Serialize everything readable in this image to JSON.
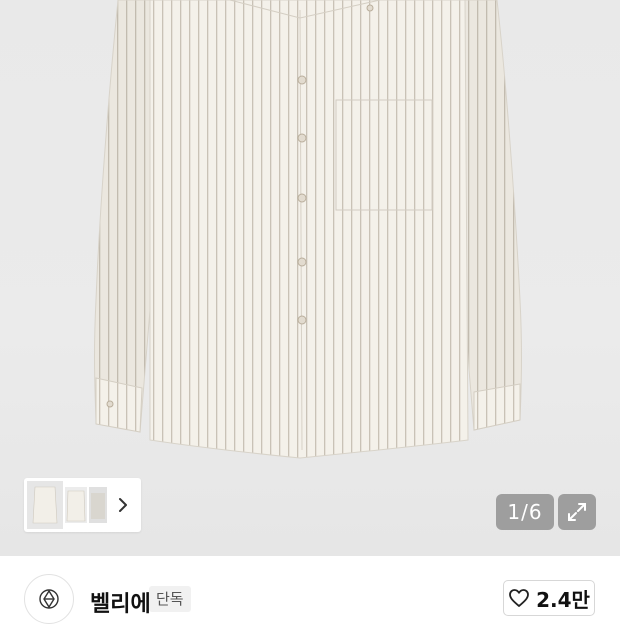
{
  "gallery": {
    "current_page": "1/6",
    "thumbnails": [
      "shirt-front",
      "shirt-front-back",
      "shirt-folded"
    ]
  },
  "brand": {
    "name": "벨리에",
    "badge": "단독"
  },
  "like": {
    "count": "2.4만"
  },
  "icons": {
    "thumb_next": "chevron-right-icon",
    "fullscreen": "expand-icon",
    "like": "heart-icon",
    "brand_logo": "brand-logo-icon"
  },
  "colors": {
    "photo_background": "#eaeaea",
    "overlay": "#828282",
    "text": "#111111"
  }
}
